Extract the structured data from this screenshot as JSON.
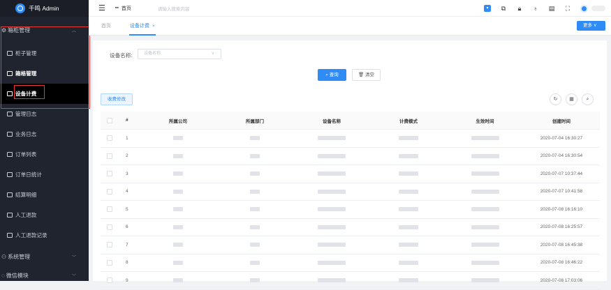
{
  "app": {
    "title": "千鸣 Admin"
  },
  "sidebar": {
    "groups": [
      {
        "label": "箱柜管理",
        "icon": "settings-icon",
        "expanded": true
      },
      {
        "label": "系统管理",
        "icon": "users-icon",
        "expanded": false
      },
      {
        "label": "微信模块",
        "icon": "chat-icon",
        "expanded": false
      }
    ],
    "items": [
      {
        "label": "柜子管理",
        "icon": "monitor-icon"
      },
      {
        "label": "箱格管理",
        "icon": "image-icon"
      },
      {
        "label": "设备计费",
        "icon": "calendar-icon",
        "active": true
      },
      {
        "label": "管理日志",
        "icon": "document-icon"
      },
      {
        "label": "业务日志",
        "icon": "document-icon"
      },
      {
        "label": "订单列表",
        "icon": "file-icon"
      },
      {
        "label": "订单日统计",
        "icon": "file-chart-icon"
      },
      {
        "label": "结算明细",
        "icon": "list-icon"
      },
      {
        "label": "人工退款",
        "icon": "grid-icon"
      },
      {
        "label": "人工退款记录",
        "icon": "user-icon"
      }
    ]
  },
  "topbar": {
    "home_label": "首页",
    "search_placeholder": "请输入搜索内容"
  },
  "tabs": {
    "home": "首页",
    "active": "设备计费",
    "close": "×",
    "more": "更多"
  },
  "filter": {
    "label": "设备名称:",
    "placeholder": "设备名称",
    "query": "查询",
    "clear": "清空"
  },
  "toolbar": {
    "fee_edit": "收费修改"
  },
  "table": {
    "headers": [
      "#",
      "所属公司",
      "所属部门",
      "设备名称",
      "计费模式",
      "生效时间",
      "创建时间"
    ],
    "rows": [
      {
        "index": "1",
        "created": "2020-07-04 16:30:27"
      },
      {
        "index": "2",
        "created": "2020-07-04 16:30:54"
      },
      {
        "index": "3",
        "created": "2020-07-07 10:37:44"
      },
      {
        "index": "4",
        "created": "2020-07-07 10:41:58"
      },
      {
        "index": "5",
        "created": "2020-07-08 16:16:10"
      },
      {
        "index": "6",
        "created": "2020-07-08 16:25:57"
      },
      {
        "index": "7",
        "created": "2020-07-08 16:45:38"
      },
      {
        "index": "8",
        "created": "2020-07-08 16:46:22"
      },
      {
        "index": "9",
        "created": "2020-07-08 17:03:06"
      }
    ]
  },
  "colors": {
    "accent": "#2f8cf7",
    "sidebar_bg": "#20242f",
    "highlight": "#e53935"
  }
}
